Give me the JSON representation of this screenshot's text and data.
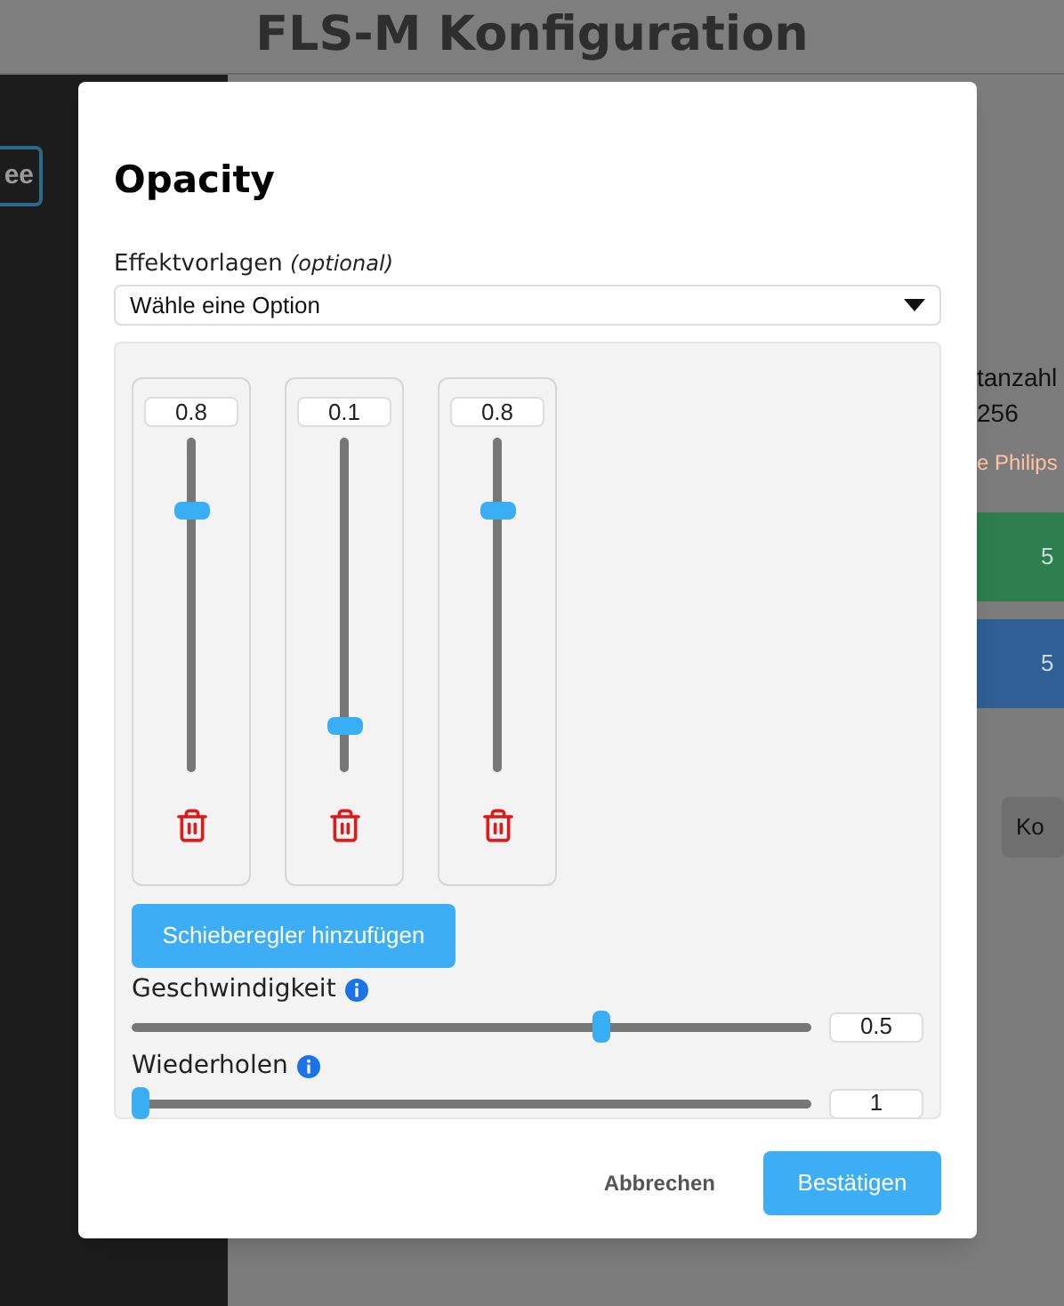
{
  "page": {
    "title": "FLS-M Konfiguration",
    "sidebar_button": "ee",
    "fragments": [
      {
        "kind": "text",
        "text": "tanzahl"
      },
      {
        "kind": "text",
        "text": "256"
      },
      {
        "kind": "accent",
        "text": "e Philips"
      },
      {
        "kind": "band",
        "text": "5",
        "color": "#2e7d4f"
      },
      {
        "kind": "band",
        "text": "5",
        "color": "#2f5f94"
      },
      {
        "kind": "button",
        "text": "Ko"
      }
    ]
  },
  "dialog": {
    "title": "Opacity",
    "preset": {
      "label": "Effektvorlagen",
      "hint": "(optional)",
      "value": "Wähle eine Option"
    },
    "sliders": [
      {
        "value": "0.8",
        "level": 0.8
      },
      {
        "value": "0.1",
        "level": 0.12
      },
      {
        "value": "0.8",
        "level": 0.8
      }
    ],
    "add_button": "Schieberegler hinzufügen",
    "settings": [
      {
        "label": "Geschwindigkeit",
        "level": 0.69,
        "value": "0.5"
      },
      {
        "label": "Wiederholen",
        "level": 0,
        "value": "1"
      }
    ],
    "buttons": [
      {
        "label": "Abbrechen",
        "primary": false
      },
      {
        "label": "Bestätigen",
        "primary": true
      }
    ]
  }
}
